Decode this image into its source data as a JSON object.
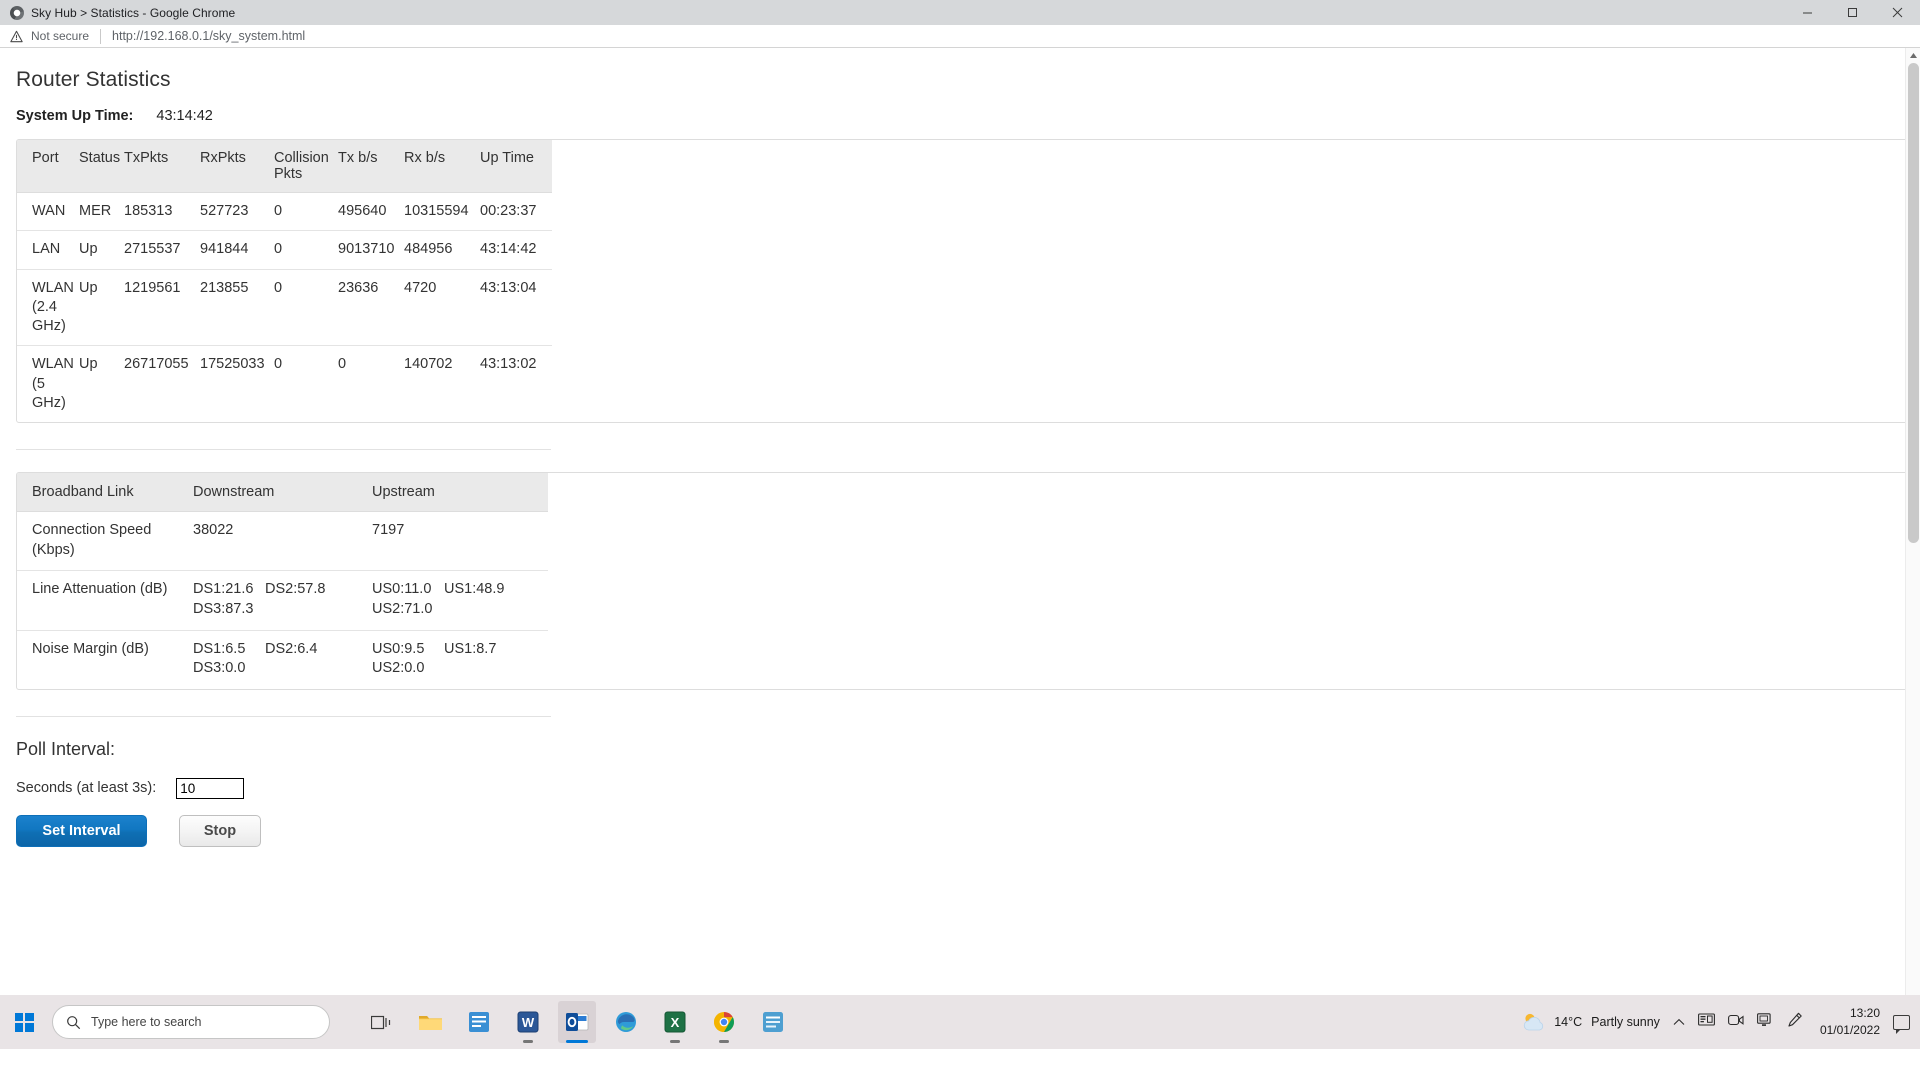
{
  "browser": {
    "tab_title": "Sky Hub > Statistics - Google Chrome",
    "favicon": "sky-globe-icon",
    "security_label": "Not secure",
    "url": "http://192.168.0.1/sky_system.html",
    "window_controls": {
      "minimize": "minimize-icon",
      "maximize": "maximize-icon",
      "close": "close-icon"
    }
  },
  "page": {
    "title": "Router Statistics",
    "uptime_label": "System Up Time:",
    "uptime_value": "43:14:42"
  },
  "port_table": {
    "headers": [
      "Port",
      "Status",
      "TxPkts",
      "RxPkts",
      "Collision Pkts",
      "Tx b/s",
      "Rx b/s",
      "Up Time"
    ],
    "rows": [
      {
        "port": "WAN",
        "status": "MER",
        "txpkts": "185313",
        "rxpkts": "527723",
        "collision": "0",
        "txbs": "495640",
        "rxbs": "10315594",
        "uptime": "00:23:37"
      },
      {
        "port": "LAN",
        "status": "Up",
        "txpkts": "2715537",
        "rxpkts": "941844",
        "collision": "0",
        "txbs": "9013710",
        "rxbs": "484956",
        "uptime": "43:14:42"
      },
      {
        "port": "WLAN (2.4 GHz)",
        "status": "Up",
        "txpkts": "1219561",
        "rxpkts": "213855",
        "collision": "0",
        "txbs": "23636",
        "rxbs": "4720",
        "uptime": "43:13:04"
      },
      {
        "port": "WLAN (5 GHz)",
        "status": "Up",
        "txpkts": "26717055",
        "rxpkts": "17525033",
        "collision": "0",
        "txbs": "0",
        "rxbs": "140702",
        "uptime": "43:13:02"
      }
    ]
  },
  "broadband_table": {
    "headers": [
      "Broadband Link",
      "Downstream",
      "Upstream"
    ],
    "rows": [
      {
        "label": "Connection Speed (Kbps)",
        "down_line1_a": "38022",
        "down_line1_b": "",
        "down_line2": "",
        "up_line1_a": "7197",
        "up_line1_b": "",
        "up_line2": ""
      },
      {
        "label": "Line Attenuation (dB)",
        "down_line1_a": "DS1:21.6",
        "down_line1_b": "DS2:57.8",
        "down_line2": "DS3:87.3",
        "up_line1_a": "US0:11.0",
        "up_line1_b": "US1:48.9",
        "up_line2": "US2:71.0"
      },
      {
        "label": "Noise Margin (dB)",
        "down_line1_a": "DS1:6.5",
        "down_line1_b": "DS2:6.4",
        "down_line2": "DS3:0.0",
        "up_line1_a": "US0:9.5",
        "up_line1_b": "US1:8.7",
        "up_line2": "US2:0.0"
      }
    ]
  },
  "poll": {
    "title": "Poll Interval:",
    "seconds_label": "Seconds (at least 3s):",
    "seconds_value": "10",
    "set_button": "Set Interval",
    "stop_button": "Stop"
  },
  "taskbar": {
    "start": "windows-start-icon",
    "search_placeholder": "Type here to search",
    "apps": [
      "task-view-icon",
      "file-explorer-icon",
      "sticky-notes-icon",
      "word-icon",
      "outlook-icon",
      "edge-icon",
      "excel-icon",
      "chrome-icon",
      "teams-icon"
    ],
    "tray": {
      "weather_icon": "partly-sunny-icon",
      "temperature": "14°C",
      "condition": "Partly sunny",
      "chevron": "chevron-up-icon",
      "icons": [
        "network-tray-icon",
        "camera-tray-icon",
        "display-tray-icon",
        "pen-tray-icon"
      ],
      "time": "13:20",
      "date": "01/01/2022",
      "action_center": "notification-icon"
    }
  },
  "colors": {
    "accent": "#1177c1",
    "header_bg": "#eaeaea",
    "taskbar_bg": "#e9e4e6",
    "titlebar_bg": "#d6d8da"
  }
}
